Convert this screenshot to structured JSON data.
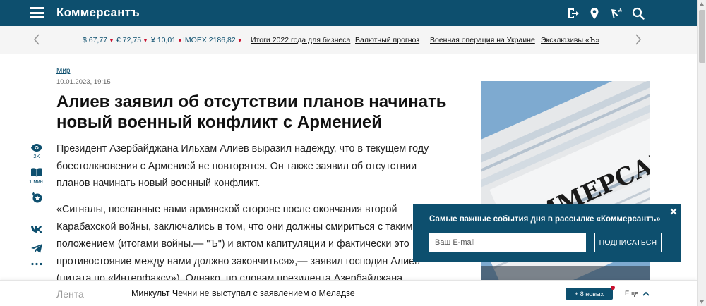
{
  "header": {
    "logo": "Коммерсантъ"
  },
  "ticker": {
    "quotes": [
      {
        "text": "$ 67,77"
      },
      {
        "text": "€ 72,75"
      },
      {
        "text": "¥ 10,01"
      },
      {
        "text": "IMOEX 2186,82"
      }
    ],
    "down_marker": "▼",
    "links": [
      "Итоги 2022 года для бизнеса",
      "Валютный прогноз",
      "Военная операция на Украине",
      "Эксклюзивы «Ъ»"
    ]
  },
  "article": {
    "rubric": "Мир",
    "date": "10.01.2023, 19:15",
    "title": "Алиев заявил об отсутствии планов начинать новый военный конфликт с Арменией",
    "lead": "Президент Азербайджана Ильхам Алиев выразил надежду, что в текущем году боестолкновения с Арменией не повторятся. Он также заявил об отсутствии планов начинать новый военный конфликт.",
    "paragraph": "«Сигналы, посланные нами армянской стороне после окончания второй Карабахской войны, заключались в том, что они должны смириться с таким положением (итогами войны.— \"Ъ\") и актом капитуляции и фактически это противостояние между нами должно закончиться»,— заявил господин Алиев (цитата по «Интерфаксу»). Однако, по словам президента Азербайджана, Армения и в Карабахе, и в направлении границы не"
  },
  "sidebar": {
    "views": "2K",
    "read_time": "1 мин."
  },
  "newsletter": {
    "title": "Самые важные события дня в рассылке «Коммерсантъ»",
    "email_placeholder": "Ваш E-mail",
    "subscribe_label": "ПОДПИСАТЬСЯ"
  },
  "feed": {
    "label": "Лента",
    "headline": "Минкульт Чечни не выступал с заявлением о Меладзе",
    "new_count": "+ 8 новых",
    "more_label": "Еще"
  },
  "colors": {
    "brand": "#0d4f6e",
    "accent_red": "#c8102e"
  }
}
